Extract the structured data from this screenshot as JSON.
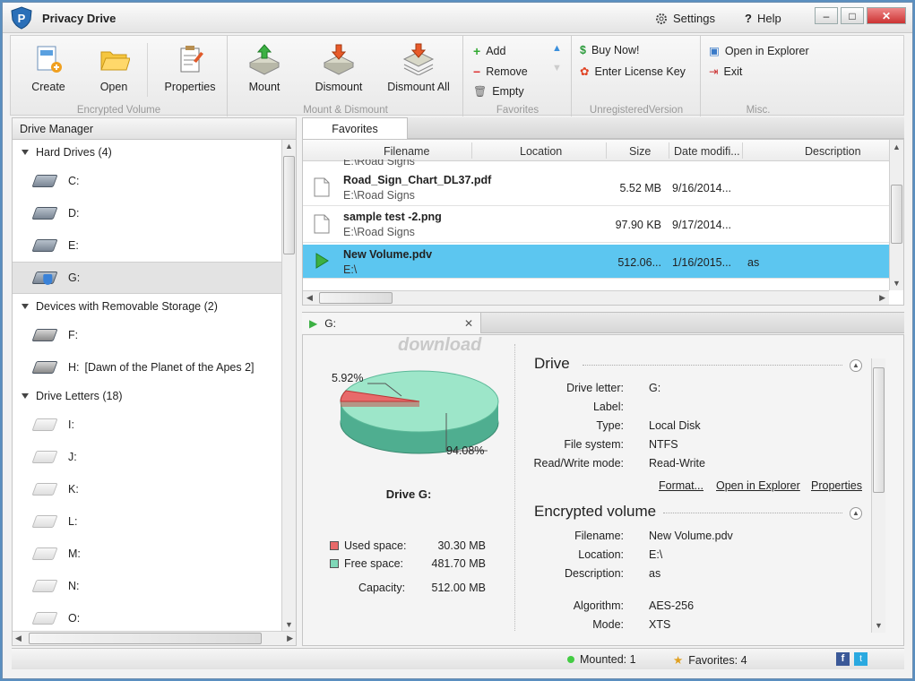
{
  "app": {
    "title": "Privacy Drive",
    "settings": "Settings",
    "help": "Help"
  },
  "ribbon": {
    "encrypted_volume": {
      "label": "Encrypted Volume",
      "create": "Create",
      "open": "Open",
      "properties": "Properties"
    },
    "mount_dismount": {
      "label": "Mount & Dismount",
      "mount": "Mount",
      "dismount": "Dismount",
      "dismount_all": "Dismount All"
    },
    "favorites": {
      "label": "Favorites",
      "add": "Add",
      "remove": "Remove",
      "empty": "Empty"
    },
    "unregistered": {
      "label": "UnregisteredVersion",
      "buy_now": "Buy Now!",
      "enter_license": "Enter License Key"
    },
    "misc": {
      "label": "Misc.",
      "open_in_explorer": "Open in Explorer",
      "exit": "Exit"
    }
  },
  "drive_manager": {
    "title": "Drive Manager",
    "groups": [
      {
        "label": "Hard Drives (4)",
        "drives": [
          "C:",
          "D:",
          "E:",
          "G:"
        ]
      },
      {
        "label": "Devices with Removable Storage (2)",
        "drives": [
          "F:",
          "H:"
        ],
        "h_note": "[Dawn of the Planet of the Apes 2]"
      },
      {
        "label": "Drive Letters (18)",
        "drives": [
          "I:",
          "J:",
          "K:",
          "L:",
          "M:",
          "N:",
          "O:"
        ]
      }
    ]
  },
  "favorites": {
    "tab": "Favorites",
    "columns": [
      "Filename",
      "Location",
      "Size",
      "Date modifi...",
      "Description"
    ],
    "partial_top": "E:\\Road Signs",
    "rows": [
      {
        "name": "Road_Sign_Chart_DL37.pdf",
        "location": "E:\\Road Signs",
        "size": "5.52 MB",
        "date": "9/16/2014...",
        "description": ""
      },
      {
        "name": "sample test -2.png",
        "location": "E:\\Road Signs",
        "size": "97.90 KB",
        "date": "9/17/2014...",
        "description": ""
      },
      {
        "name": "New Volume.pdv",
        "location": "E:\\",
        "size": "512.06...",
        "date": "1/16/2015...",
        "description": "as"
      }
    ]
  },
  "detail": {
    "tab": "G:",
    "watermark": "download",
    "chart": {
      "used_pct": "5.92%",
      "free_pct": "94.08%",
      "drive_label": "Drive G:",
      "used_label": "Used space:",
      "used_value": "30.30 MB",
      "free_label": "Free space:",
      "free_value": "481.70 MB",
      "capacity_label": "Capacity:",
      "capacity_value": "512.00 MB",
      "used_color": "#e86a6a",
      "free_color": "#7fd8b8"
    },
    "drive": {
      "title": "Drive",
      "fields": [
        {
          "k": "Drive letter:",
          "v": "G:"
        },
        {
          "k": "Label:",
          "v": ""
        },
        {
          "k": "Type:",
          "v": "Local Disk"
        },
        {
          "k": "File system:",
          "v": "NTFS"
        },
        {
          "k": "Read/Write mode:",
          "v": "Read-Write"
        }
      ],
      "links": [
        "Format...",
        "Open in Explorer",
        "Properties"
      ]
    },
    "volume": {
      "title": "Encrypted volume",
      "fields": [
        {
          "k": "Filename:",
          "v": "New Volume.pdv"
        },
        {
          "k": "Location:",
          "v": "E:\\"
        },
        {
          "k": "Description:",
          "v": "as"
        },
        {
          "k": "Algorithm:",
          "v": "AES-256"
        },
        {
          "k": "Mode:",
          "v": "XTS"
        }
      ]
    }
  },
  "status": {
    "mounted": "Mounted: 1",
    "favorites": "Favorites: 4"
  }
}
